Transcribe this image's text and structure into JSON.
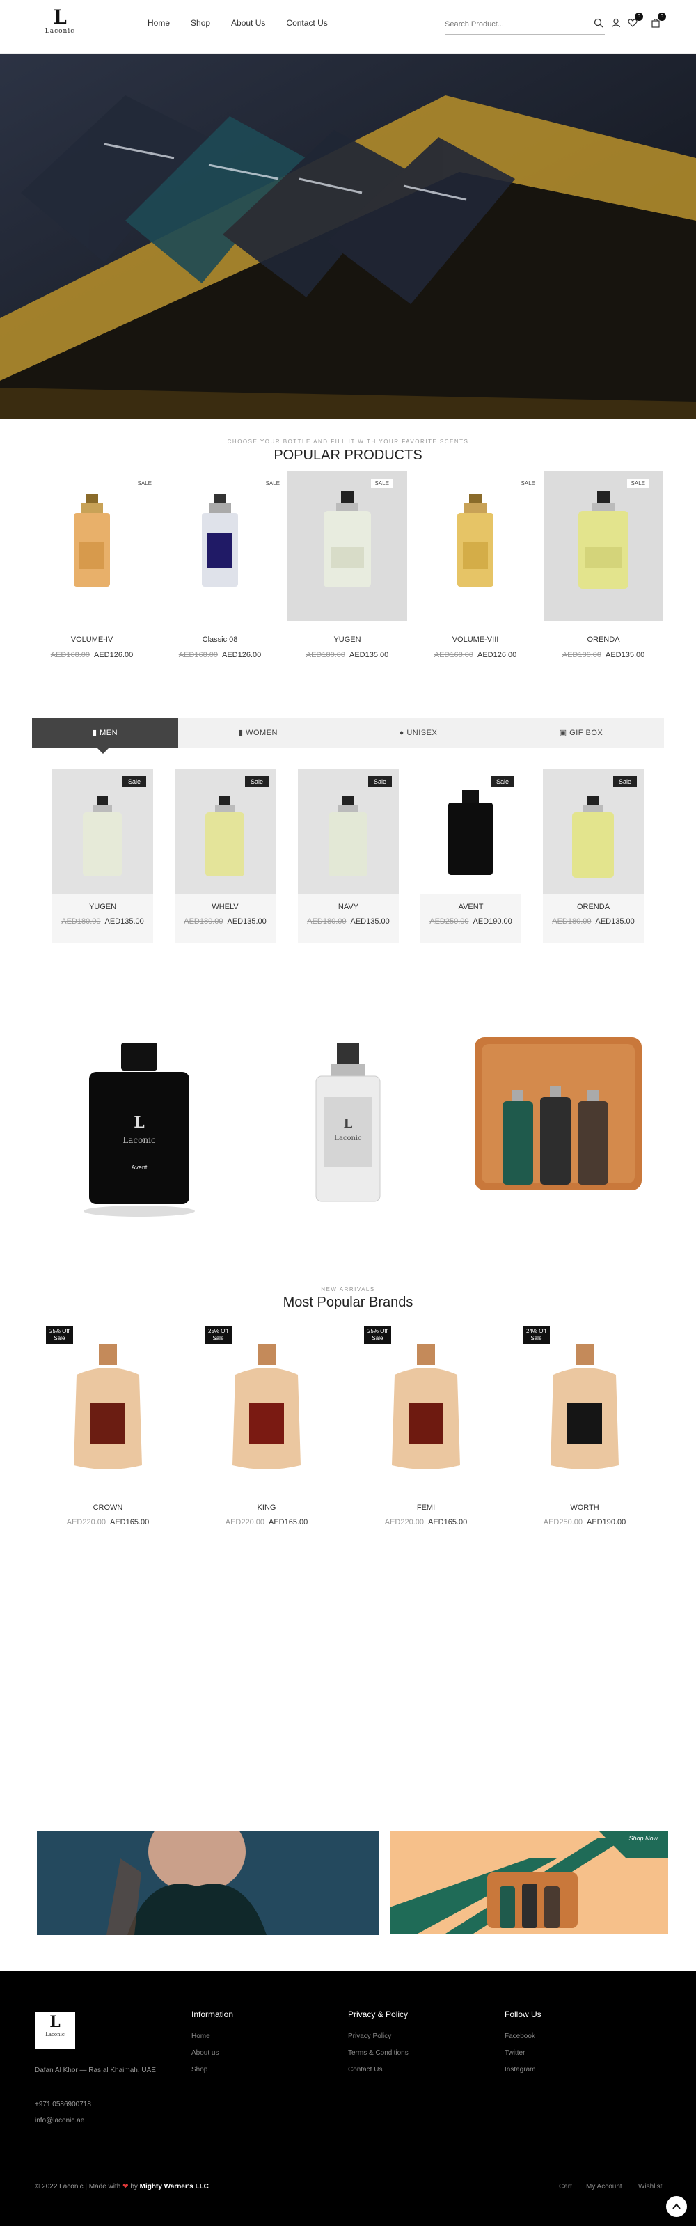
{
  "header": {
    "logo_word": "Laconic",
    "nav": [
      "Home",
      "Shop",
      "About Us",
      "Contact Us"
    ],
    "search_placeholder": "Search Product...",
    "wishlist_count": "0",
    "cart_count": "0"
  },
  "popular": {
    "eyebrow": "CHOOSE YOUR BOTTLE AND FILL IT WITH YOUR FAVORITE SCENTS",
    "title": "POPULAR PRODUCTS",
    "products": [
      {
        "name": "VOLUME-IV",
        "old_price": "AED168.00",
        "price": "AED126.00",
        "badge": "SALE"
      },
      {
        "name": "Classic 08",
        "old_price": "AED168.00",
        "price": "AED126.00",
        "badge": "SALE"
      },
      {
        "name": "YUGEN",
        "old_price": "AED180.00",
        "price": "AED135.00",
        "badge": "SALE"
      },
      {
        "name": "VOLUME-VIII",
        "old_price": "AED168.00",
        "price": "AED126.00",
        "badge": "SALE"
      },
      {
        "name": "ORENDA",
        "old_price": "AED180.00",
        "price": "AED135.00",
        "badge": "SALE"
      }
    ]
  },
  "tabs": {
    "items": [
      "MEN",
      "WOMEN",
      "UNISEX",
      "GIF BOX"
    ],
    "products": [
      {
        "name": "YUGEN",
        "old_price": "AED180.00",
        "price": "AED135.00",
        "badge": "Sale"
      },
      {
        "name": "WHELV",
        "old_price": "AED180.00",
        "price": "AED135.00",
        "badge": "Sale"
      },
      {
        "name": "NAVY",
        "old_price": "AED180.00",
        "price": "AED135.00",
        "badge": "Sale"
      },
      {
        "name": "AVENT",
        "old_price": "AED250.00",
        "price": "AED190.00",
        "badge": "Sale"
      },
      {
        "name": "ORENDA",
        "old_price": "AED180.00",
        "price": "AED135.00",
        "badge": "Sale"
      }
    ]
  },
  "showcase": {
    "bottle1_label": "Avent",
    "bottle1_brand": "Laconic",
    "bottle2_brand": "Laconic"
  },
  "brands": {
    "eyebrow": "NEW ARRIVALS",
    "title": "Most Popular Brands",
    "products": [
      {
        "name": "CROWN",
        "old_price": "AED220.00",
        "price": "AED165.00",
        "pct": "25% Off",
        "badge": "Sale"
      },
      {
        "name": "KING",
        "old_price": "AED220.00",
        "price": "AED165.00",
        "pct": "25% Off",
        "badge": "Sale"
      },
      {
        "name": "FEMI",
        "old_price": "AED220.00",
        "price": "AED165.00",
        "pct": "25% Off",
        "badge": "Sale"
      },
      {
        "name": "WORTH",
        "old_price": "AED250.00",
        "price": "AED190.00",
        "pct": "24% Off",
        "badge": "Sale"
      }
    ]
  },
  "banners": {
    "right_corner": "Shop Now"
  },
  "footer": {
    "logo_word": "Laconic",
    "address": "Dafan Al Khor — Ras al Khaimah, UAE",
    "phone": "+971 0586900718",
    "email": "info@laconic.ae",
    "columns": [
      {
        "title": "Information",
        "links": [
          "Home",
          "About us",
          "Shop"
        ]
      },
      {
        "title": "Privacy & Policy",
        "links": [
          "Privacy Policy",
          "Terms & Conditions",
          "Contact Us"
        ]
      },
      {
        "title": "Follow Us",
        "links": [
          "Facebook",
          "Twitter",
          "Instagram"
        ]
      }
    ],
    "copyright": "© 2022 Laconic | Made with",
    "by": "by",
    "company": "Mighty Warner's LLC",
    "bottom_links": [
      "Cart",
      "My Account",
      "Wishlist"
    ]
  },
  "colors": {
    "accent_dark": "#444444",
    "footer_bg": "#000000",
    "banner_green": "#1f6b57",
    "banner_peach": "#f6c08a"
  }
}
